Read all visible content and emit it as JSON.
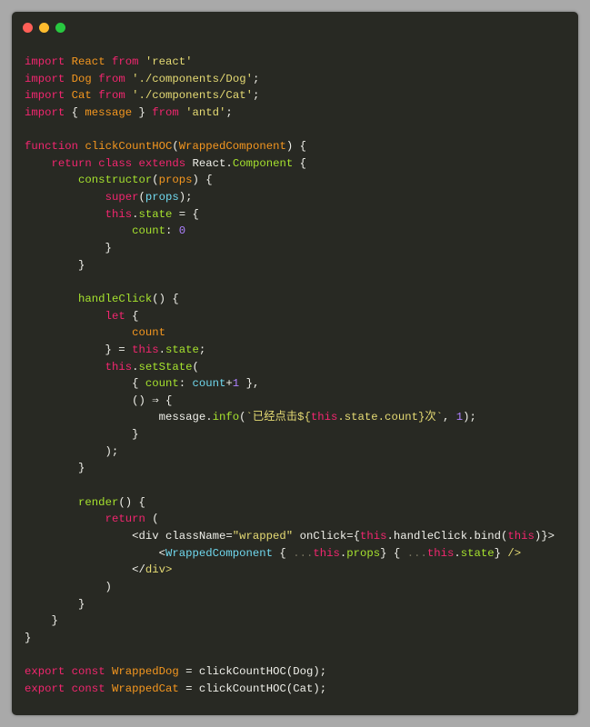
{
  "window": {
    "controls": [
      {
        "name": "close",
        "color": "#ff5f57"
      },
      {
        "name": "minimize",
        "color": "#febc2e"
      },
      {
        "name": "maximize",
        "color": "#28c840"
      }
    ]
  },
  "colors": {
    "keyword": "#f2266f",
    "class": "#f5971f",
    "string": "#e6db74",
    "function": "#a6e22e",
    "variable": "#70d8ee",
    "number": "#ae81ff",
    "background": "#282923"
  },
  "code_lines": [
    [
      [
        "k",
        "import"
      ],
      [
        "w",
        " "
      ],
      [
        "o",
        "React"
      ],
      [
        "w",
        " "
      ],
      [
        "k",
        "from"
      ],
      [
        "w",
        " "
      ],
      [
        "s",
        "'react'"
      ]
    ],
    [
      [
        "k",
        "import"
      ],
      [
        "w",
        " "
      ],
      [
        "o",
        "Dog"
      ],
      [
        "w",
        " "
      ],
      [
        "k",
        "from"
      ],
      [
        "w",
        " "
      ],
      [
        "s",
        "'./components/Dog'"
      ],
      [
        "w",
        ";"
      ]
    ],
    [
      [
        "k",
        "import"
      ],
      [
        "w",
        " "
      ],
      [
        "o",
        "Cat"
      ],
      [
        "w",
        " "
      ],
      [
        "k",
        "from"
      ],
      [
        "w",
        " "
      ],
      [
        "s",
        "'./components/Cat'"
      ],
      [
        "w",
        ";"
      ]
    ],
    [
      [
        "k",
        "import"
      ],
      [
        "w",
        " { "
      ],
      [
        "o",
        "message"
      ],
      [
        "w",
        " } "
      ],
      [
        "k",
        "from"
      ],
      [
        "w",
        " "
      ],
      [
        "s",
        "'antd'"
      ],
      [
        "w",
        ";"
      ]
    ],
    [],
    [
      [
        "k",
        "function"
      ],
      [
        "w",
        " "
      ],
      [
        "o",
        "clickCountHOC"
      ],
      [
        "w",
        "("
      ],
      [
        "o",
        "WrappedComponent"
      ],
      [
        "w",
        ") {"
      ]
    ],
    [
      [
        "w",
        "    "
      ],
      [
        "k",
        "return"
      ],
      [
        "w",
        " "
      ],
      [
        "k",
        "class"
      ],
      [
        "w",
        " "
      ],
      [
        "k",
        "extends"
      ],
      [
        "w",
        " React."
      ],
      [
        "g",
        "Component"
      ],
      [
        "w",
        " {"
      ]
    ],
    [
      [
        "w",
        "        "
      ],
      [
        "g",
        "constructor"
      ],
      [
        "w",
        "("
      ],
      [
        "o",
        "props"
      ],
      [
        "w",
        ") {"
      ]
    ],
    [
      [
        "w",
        "            "
      ],
      [
        "k",
        "super"
      ],
      [
        "w",
        "("
      ],
      [
        "c",
        "props"
      ],
      [
        "w",
        ");"
      ]
    ],
    [
      [
        "w",
        "            "
      ],
      [
        "k",
        "this"
      ],
      [
        "w",
        "."
      ],
      [
        "g",
        "state"
      ],
      [
        "w",
        " = {"
      ]
    ],
    [
      [
        "w",
        "                "
      ],
      [
        "g",
        "count"
      ],
      [
        "w",
        ": "
      ],
      [
        "n",
        "0"
      ]
    ],
    [
      [
        "w",
        "            }"
      ]
    ],
    [
      [
        "w",
        "        }"
      ]
    ],
    [],
    [
      [
        "w",
        "        "
      ],
      [
        "g",
        "handleClick"
      ],
      [
        "w",
        "() {"
      ]
    ],
    [
      [
        "w",
        "            "
      ],
      [
        "k",
        "let"
      ],
      [
        "w",
        " {"
      ]
    ],
    [
      [
        "w",
        "                "
      ],
      [
        "o",
        "count"
      ]
    ],
    [
      [
        "w",
        "            } = "
      ],
      [
        "k",
        "this"
      ],
      [
        "w",
        "."
      ],
      [
        "g",
        "state"
      ],
      [
        "w",
        ";"
      ]
    ],
    [
      [
        "w",
        "            "
      ],
      [
        "k",
        "this"
      ],
      [
        "w",
        "."
      ],
      [
        "g",
        "setState"
      ],
      [
        "w",
        "("
      ]
    ],
    [
      [
        "w",
        "                { "
      ],
      [
        "g",
        "count"
      ],
      [
        "w",
        ": "
      ],
      [
        "c",
        "count"
      ],
      [
        "w",
        "+"
      ],
      [
        "n",
        "1"
      ],
      [
        "w",
        " },"
      ]
    ],
    [
      [
        "w",
        "                () ⇒ {"
      ]
    ],
    [
      [
        "w",
        "                    message."
      ],
      [
        "g",
        "info"
      ],
      [
        "w",
        "("
      ],
      [
        "s",
        "`已经点击${"
      ],
      [
        "k",
        "this"
      ],
      [
        "s",
        ".state.count}次`"
      ],
      [
        "w",
        ", "
      ],
      [
        "n",
        "1"
      ],
      [
        "w",
        ");"
      ]
    ],
    [
      [
        "w",
        "                }"
      ]
    ],
    [
      [
        "w",
        "            );"
      ]
    ],
    [
      [
        "w",
        "        }"
      ]
    ],
    [],
    [
      [
        "w",
        "        "
      ],
      [
        "g",
        "render"
      ],
      [
        "w",
        "() {"
      ]
    ],
    [
      [
        "w",
        "            "
      ],
      [
        "k",
        "return"
      ],
      [
        "w",
        " ("
      ]
    ],
    [
      [
        "w",
        "                <div className="
      ],
      [
        "s",
        "\"wrapped\""
      ],
      [
        "w",
        " onClick={"
      ],
      [
        "k",
        "this"
      ],
      [
        "w",
        ".handleClick.bind("
      ],
      [
        "k",
        "this"
      ],
      [
        "w",
        ")}>"
      ]
    ],
    [
      [
        "w",
        "                    <"
      ],
      [
        "c",
        "WrappedComponent"
      ],
      [
        "w",
        " { "
      ],
      [
        "d",
        "..."
      ],
      [
        "k",
        "this"
      ],
      [
        "w",
        "."
      ],
      [
        "g",
        "props"
      ],
      [
        "w",
        "} { "
      ],
      [
        "d",
        "..."
      ],
      [
        "k",
        "this"
      ],
      [
        "w",
        "."
      ],
      [
        "g",
        "state"
      ],
      [
        "w",
        "} "
      ],
      [
        "s",
        "/>"
      ]
    ],
    [
      [
        "w",
        "                </"
      ],
      [
        "s",
        "div>"
      ]
    ],
    [
      [
        "w",
        "            )"
      ]
    ],
    [
      [
        "w",
        "        }"
      ]
    ],
    [
      [
        "w",
        "    }"
      ]
    ],
    [
      [
        "w",
        "}"
      ]
    ],
    [],
    [
      [
        "k",
        "export"
      ],
      [
        "w",
        " "
      ],
      [
        "k",
        "const"
      ],
      [
        "w",
        " "
      ],
      [
        "o",
        "WrappedDog"
      ],
      [
        "w",
        " = clickCountHOC(Dog);"
      ]
    ],
    [
      [
        "k",
        "export"
      ],
      [
        "w",
        " "
      ],
      [
        "k",
        "const"
      ],
      [
        "w",
        " "
      ],
      [
        "o",
        "WrappedCat"
      ],
      [
        "w",
        " = clickCountHOC(Cat);"
      ]
    ]
  ]
}
